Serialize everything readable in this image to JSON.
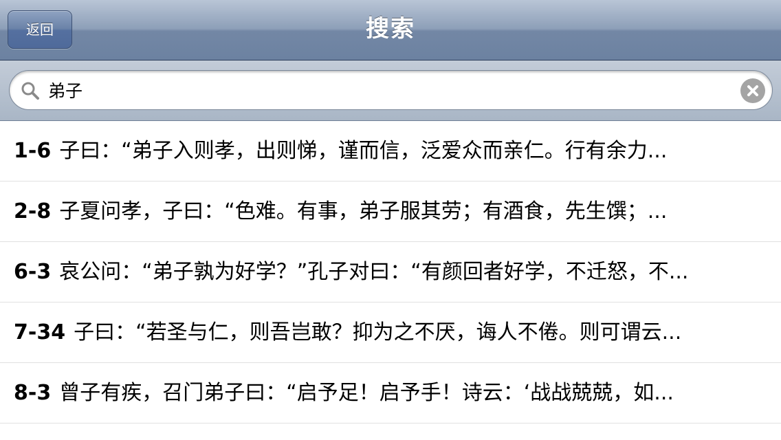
{
  "navbar": {
    "back_label": "返回",
    "title": "搜索"
  },
  "search": {
    "value": "弟子",
    "placeholder": ""
  },
  "results": [
    {
      "ref": "1-6",
      "text": "子曰：“弟子入则孝，出则悌，谨而信，泛爱众而亲仁。行有余力..."
    },
    {
      "ref": "2-8",
      "text": "子夏问孝，子曰：“色难。有事，弟子服其劳；有酒食，先生馔；..."
    },
    {
      "ref": "6-3",
      "text": "哀公问：“弟子孰为好学？”孔子对曰：“有颜回者好学，不迁怒，不..."
    },
    {
      "ref": "7-34",
      "text": "子曰：“若圣与仁，则吾岂敢？抑为之不厌，诲人不倦。则可谓云..."
    },
    {
      "ref": "8-3",
      "text": "曾子有疾，召门弟子曰：“启予足！启予手！诗云：‘战战兢兢，如..."
    }
  ],
  "icons": {
    "search": "search-icon",
    "clear": "clear-icon"
  },
  "colors": {
    "navbar": "#8d9fb8",
    "back_button": "#5570a0",
    "clear_button": "#a4a4a4"
  }
}
